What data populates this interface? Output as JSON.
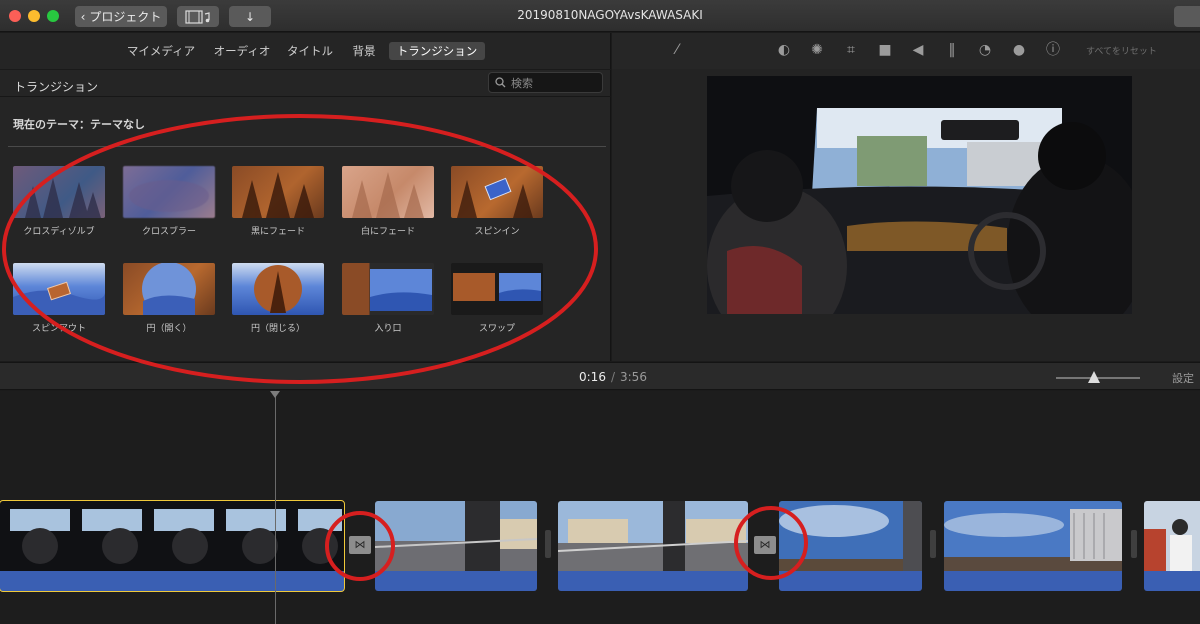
{
  "window": {
    "title": "20190810NAGOYAvsKAWASAKI",
    "back_label": "プロジェクト",
    "back_icon": "chevron-left-icon",
    "media_icon": "film-music-icon",
    "import_icon": "down-arrow-icon",
    "share_icon": "share-icon"
  },
  "browser": {
    "tabs": [
      {
        "label": "マイメディア",
        "active": false
      },
      {
        "label": "オーディオ",
        "active": false
      },
      {
        "label": "タイトル",
        "active": false
      },
      {
        "label": "背景",
        "active": false
      },
      {
        "label": "トランジション",
        "active": true
      }
    ],
    "panel_title": "トランジション",
    "search_placeholder": "検索",
    "theme_label": "現在のテーマ：テーマなし",
    "transitions": [
      {
        "label": "クロスディゾルブ"
      },
      {
        "label": "クロスブラー"
      },
      {
        "label": "黒にフェード"
      },
      {
        "label": "白にフェード"
      },
      {
        "label": "スピンイン"
      },
      {
        "label": "スピンアウト"
      },
      {
        "label": "円（開く）"
      },
      {
        "label": "円（閉じる）"
      },
      {
        "label": "入り口"
      },
      {
        "label": "スワップ"
      }
    ]
  },
  "viewer": {
    "tools": [
      "magic-wand-icon",
      "color-balance-icon",
      "palette-icon",
      "crop-icon",
      "camera-icon",
      "volume-icon",
      "equalizer-icon",
      "speed-gauge-icon",
      "filter-icon",
      "info-icon"
    ],
    "reset_label": "すべてをリセット"
  },
  "timebar": {
    "current": "0:16",
    "separator": "/",
    "total": "3:56",
    "zoom_level": 0.45,
    "settings_label": "設定"
  },
  "timeline": {
    "transition_icon": "bowtie-transition-icon"
  },
  "colors": {
    "accent_selected": "#f0c93a",
    "annotation": "#d61f1f",
    "audio": "#3a5fb3"
  }
}
